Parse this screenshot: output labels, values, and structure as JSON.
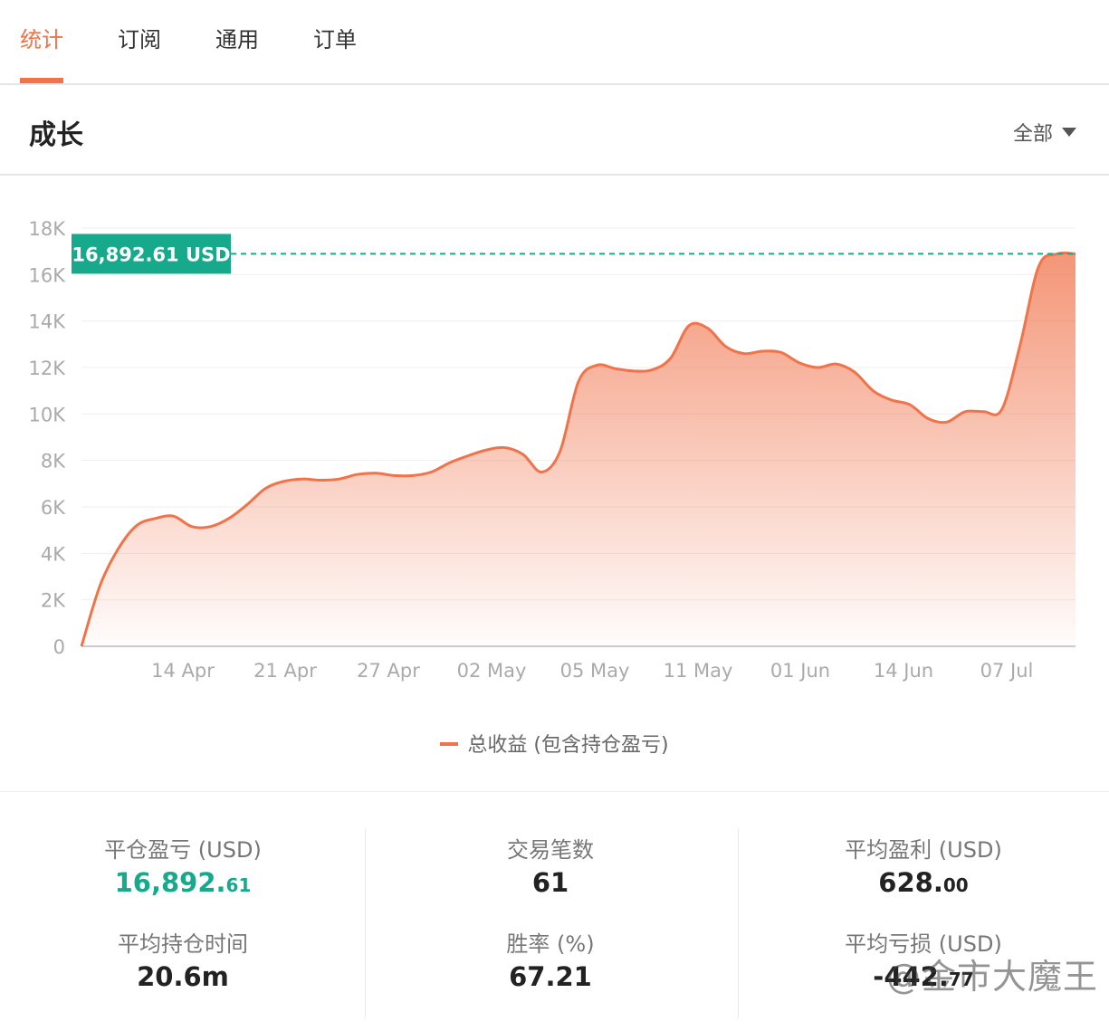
{
  "tabs": [
    {
      "label": "统计",
      "active": true
    },
    {
      "label": "订阅",
      "active": false
    },
    {
      "label": "通用",
      "active": false
    },
    {
      "label": "订单",
      "active": false
    }
  ],
  "section": {
    "title": "成长",
    "filter_label": "全部"
  },
  "colors": {
    "accent": "#f0734a",
    "green": "#17a98b",
    "tag_bg": "#17a98b"
  },
  "chart_data": {
    "type": "area",
    "title": "",
    "series": [
      {
        "name": "总收益 (包含持仓盈亏)",
        "values": [
          0,
          2600,
          4200,
          5200,
          5500,
          5600,
          5150,
          5150,
          5500,
          6100,
          6800,
          7100,
          7200,
          7150,
          7200,
          7400,
          7450,
          7350,
          7350,
          7500,
          7900,
          8200,
          8450,
          8550,
          8250,
          7500,
          8400,
          11400,
          12100,
          11950,
          11850,
          11900,
          12400,
          13800,
          13700,
          12900,
          12600,
          12700,
          12650,
          12200,
          12000,
          12150,
          11800,
          11000,
          10600,
          10400,
          9800,
          9650,
          10100,
          10100,
          10200,
          13000,
          16350,
          16890,
          16890
        ]
      }
    ],
    "x_labels": [
      "14 Apr",
      "21 Apr",
      "27 Apr",
      "02 May",
      "05 May",
      "11 May",
      "01 Jun",
      "14 Jun",
      "07 Jul"
    ],
    "y_ticks": [
      "0",
      "2K",
      "4K",
      "6K",
      "8K",
      "10K",
      "12K",
      "14K",
      "16K",
      "18K"
    ],
    "ylim": [
      0,
      18000
    ],
    "current_value": 16892.61,
    "current_label": "16,892.61 USD",
    "grid": true,
    "legend_position": "bottom-center"
  },
  "stats": {
    "closed_pnl": {
      "label": "平仓盈亏 (USD)",
      "int": "16,892.",
      "dec": "61"
    },
    "avg_hold_time": {
      "label": "平均持仓时间",
      "value": "20.6m"
    },
    "trade_count": {
      "label": "交易笔数",
      "value": "61"
    },
    "win_rate": {
      "label": "胜率 (%)",
      "value": "67.21"
    },
    "avg_profit": {
      "label": "平均盈利 (USD)",
      "int": "628.",
      "dec": "00"
    },
    "avg_loss": {
      "label": "平均亏损 (USD)",
      "int": "-442.",
      "dec": "77"
    }
  },
  "watermark": "@金市大魔王"
}
